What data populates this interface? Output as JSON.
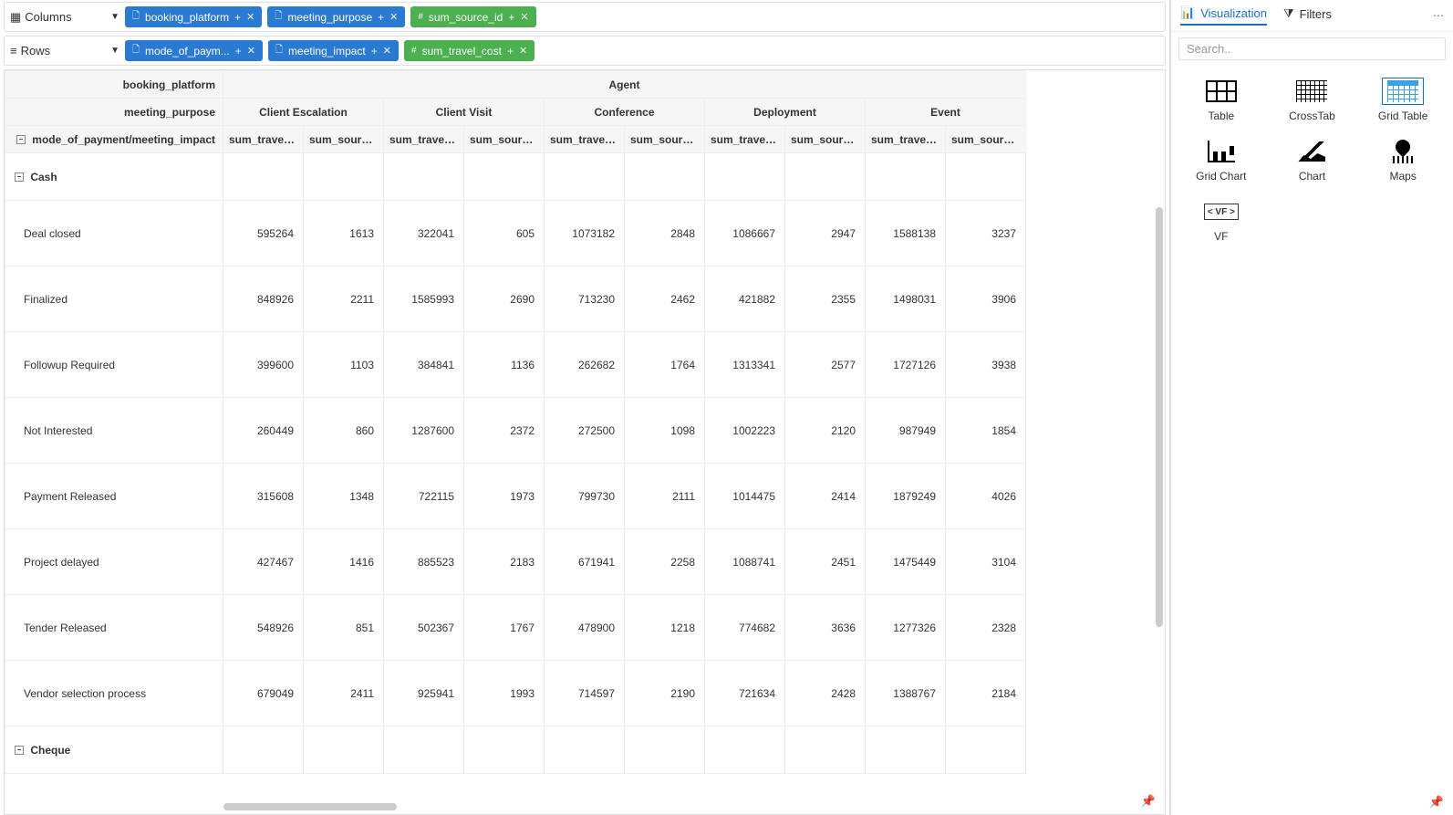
{
  "shelves": {
    "columns_label": "Columns",
    "rows_label": "Rows",
    "columns": [
      {
        "text": "booking_platform",
        "kind": "dim"
      },
      {
        "text": "meeting_purpose",
        "kind": "dim"
      },
      {
        "text": "sum_source_id",
        "kind": "measure"
      }
    ],
    "rows": [
      {
        "text": "mode_of_paym...",
        "kind": "dim"
      },
      {
        "text": "meeting_impact",
        "kind": "dim"
      },
      {
        "text": "sum_travel_cost",
        "kind": "measure"
      }
    ]
  },
  "crosstab": {
    "col_dim_headers": [
      "booking_platform",
      "meeting_purpose"
    ],
    "row_header_label": "mode_of_payment/meeting_impact",
    "top_group": "Agent",
    "purposes": [
      "Client Escalation",
      "Client Visit",
      "Conference",
      "Deployment",
      "Event"
    ],
    "measures": [
      "sum_travel_...",
      "sum_source..."
    ],
    "groups": [
      {
        "name": "Cash",
        "rows": [
          {
            "label": "Deal closed",
            "vals": [
              595264,
              1613,
              322041,
              605,
              1073182,
              2848,
              1086667,
              2947,
              1588138,
              3237
            ]
          },
          {
            "label": "Finalized",
            "vals": [
              848926,
              2211,
              1585993,
              2690,
              713230,
              2462,
              421882,
              2355,
              1498031,
              3906
            ]
          },
          {
            "label": "Followup Required",
            "vals": [
              399600,
              1103,
              384841,
              1136,
              262682,
              1764,
              1313341,
              2577,
              1727126,
              3938
            ]
          },
          {
            "label": "Not Interested",
            "vals": [
              260449,
              860,
              1287600,
              2372,
              272500,
              1098,
              1002223,
              2120,
              987949,
              1854
            ]
          },
          {
            "label": "Payment Released",
            "vals": [
              315608,
              1348,
              722115,
              1973,
              799730,
              2111,
              1014475,
              2414,
              1879249,
              4026
            ]
          },
          {
            "label": "Project delayed",
            "vals": [
              427467,
              1416,
              885523,
              2183,
              671941,
              2258,
              1088741,
              2451,
              1475449,
              3104
            ]
          },
          {
            "label": "Tender Released",
            "vals": [
              548926,
              851,
              502367,
              1767,
              478900,
              1218,
              774682,
              3636,
              1277326,
              2328
            ]
          },
          {
            "label": "Vendor selection process",
            "vals": [
              679049,
              2411,
              925941,
              1993,
              714597,
              2190,
              721634,
              2428,
              1388767,
              2184
            ]
          }
        ]
      },
      {
        "name": "Cheque",
        "rows": []
      }
    ]
  },
  "side": {
    "tab_viz": "Visualization",
    "tab_filters": "Filters",
    "search_placeholder": "Search..",
    "items": [
      {
        "label": "Table",
        "icon": "table"
      },
      {
        "label": "CrossTab",
        "icon": "crosstab"
      },
      {
        "label": "Grid Table",
        "icon": "gridtable"
      },
      {
        "label": "Grid Chart",
        "icon": "barchart"
      },
      {
        "label": "Chart",
        "icon": "chart"
      },
      {
        "label": "Maps",
        "icon": "maps"
      },
      {
        "label": "VF",
        "icon": "vf"
      }
    ],
    "vf_text": "< VF >"
  },
  "chart_data": {
    "type": "table",
    "row_dimensions": [
      "mode_of_payment",
      "meeting_impact"
    ],
    "col_dimensions": [
      "booking_platform",
      "meeting_purpose"
    ],
    "measures": [
      "sum_travel_cost",
      "sum_source_id"
    ],
    "booking_platform_shown": "Agent",
    "meeting_purpose_values": [
      "Client Escalation",
      "Client Visit",
      "Conference",
      "Deployment",
      "Event"
    ],
    "data": {
      "Cash": {
        "Deal closed": {
          "Client Escalation": [
            595264,
            1613
          ],
          "Client Visit": [
            322041,
            605
          ],
          "Conference": [
            1073182,
            2848
          ],
          "Deployment": [
            1086667,
            2947
          ],
          "Event": [
            1588138,
            3237
          ]
        },
        "Finalized": {
          "Client Escalation": [
            848926,
            2211
          ],
          "Client Visit": [
            1585993,
            2690
          ],
          "Conference": [
            713230,
            2462
          ],
          "Deployment": [
            421882,
            2355
          ],
          "Event": [
            1498031,
            3906
          ]
        },
        "Followup Required": {
          "Client Escalation": [
            399600,
            1103
          ],
          "Client Visit": [
            384841,
            1136
          ],
          "Conference": [
            262682,
            1764
          ],
          "Deployment": [
            1313341,
            2577
          ],
          "Event": [
            1727126,
            3938
          ]
        },
        "Not Interested": {
          "Client Escalation": [
            260449,
            860
          ],
          "Client Visit": [
            1287600,
            2372
          ],
          "Conference": [
            272500,
            1098
          ],
          "Deployment": [
            1002223,
            2120
          ],
          "Event": [
            987949,
            1854
          ]
        },
        "Payment Released": {
          "Client Escalation": [
            315608,
            1348
          ],
          "Client Visit": [
            722115,
            1973
          ],
          "Conference": [
            799730,
            2111
          ],
          "Deployment": [
            1014475,
            2414
          ],
          "Event": [
            1879249,
            4026
          ]
        },
        "Project delayed": {
          "Client Escalation": [
            427467,
            1416
          ],
          "Client Visit": [
            885523,
            2183
          ],
          "Conference": [
            671941,
            2258
          ],
          "Deployment": [
            1088741,
            2451
          ],
          "Event": [
            1475449,
            3104
          ]
        },
        "Tender Released": {
          "Client Escalation": [
            548926,
            851
          ],
          "Client Visit": [
            502367,
            1767
          ],
          "Conference": [
            478900,
            1218
          ],
          "Deployment": [
            774682,
            3636
          ],
          "Event": [
            1277326,
            2328
          ]
        },
        "Vendor selection process": {
          "Client Escalation": [
            679049,
            2411
          ],
          "Client Visit": [
            925941,
            1993
          ],
          "Conference": [
            714597,
            2190
          ],
          "Deployment": [
            721634,
            2428
          ],
          "Event": [
            1388767,
            2184
          ]
        }
      },
      "Cheque": {}
    }
  }
}
